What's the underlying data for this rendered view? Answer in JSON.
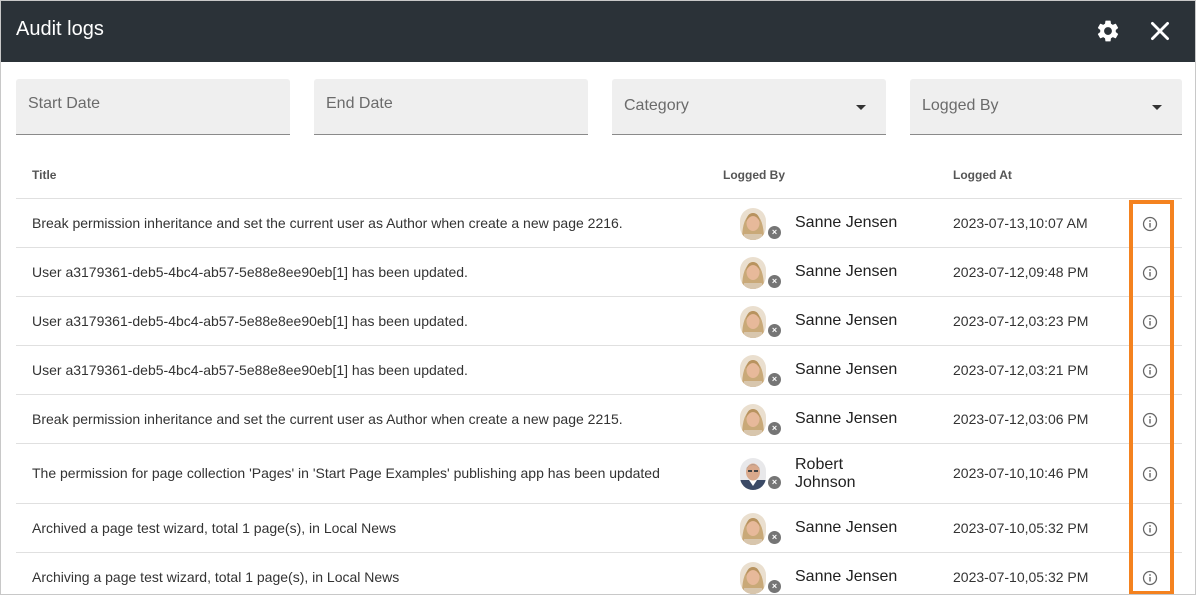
{
  "dialog": {
    "title": "Audit logs",
    "icons": {
      "settings": "gear-icon",
      "close": "close-icon"
    }
  },
  "filters": {
    "start_date": {
      "placeholder": "Start Date"
    },
    "end_date": {
      "placeholder": "End Date"
    },
    "category": {
      "placeholder": "Category"
    },
    "logged_by": {
      "placeholder": "Logged By"
    }
  },
  "table": {
    "columns": {
      "title": "Title",
      "logged_by": "Logged By",
      "logged_at": "Logged At"
    },
    "rows": [
      {
        "title": "Break permission inheritance and set the current user as Author when create a new page 2216.",
        "user": "Sanne Jensen",
        "logged_at": "2023-07-13,10:07 AM"
      },
      {
        "title": "User a3179361-deb5-4bc4-ab57-5e88e8ee90eb[1] has been updated.",
        "user": "Sanne Jensen",
        "logged_at": "2023-07-12,09:48 PM"
      },
      {
        "title": "User a3179361-deb5-4bc4-ab57-5e88e8ee90eb[1] has been updated.",
        "user": "Sanne Jensen",
        "logged_at": "2023-07-12,03:23 PM"
      },
      {
        "title": "User a3179361-deb5-4bc4-ab57-5e88e8ee90eb[1] has been updated.",
        "user": "Sanne Jensen",
        "logged_at": "2023-07-12,03:21 PM"
      },
      {
        "title": "Break permission inheritance and set the current user as Author when create a new page 2215.",
        "user": "Sanne Jensen",
        "logged_at": "2023-07-12,03:06 PM"
      },
      {
        "title": "The permission for page collection 'Pages' in 'Start Page Examples' publishing app has been updated",
        "user": "Robert Johnson",
        "logged_at": "2023-07-10,10:46 PM"
      },
      {
        "title": "Archived a page test wizard, total 1 page(s), in Local News",
        "user": "Sanne Jensen",
        "logged_at": "2023-07-10,05:32 PM"
      },
      {
        "title": "Archiving a page test wizard, total 1 page(s), in Local News",
        "user": "Sanne Jensen",
        "logged_at": "2023-07-10,05:32 PM"
      }
    ]
  },
  "colors": {
    "titlebar_bg": "#2b3238",
    "highlight": "#f4821f",
    "filter_bg": "#efefef"
  }
}
